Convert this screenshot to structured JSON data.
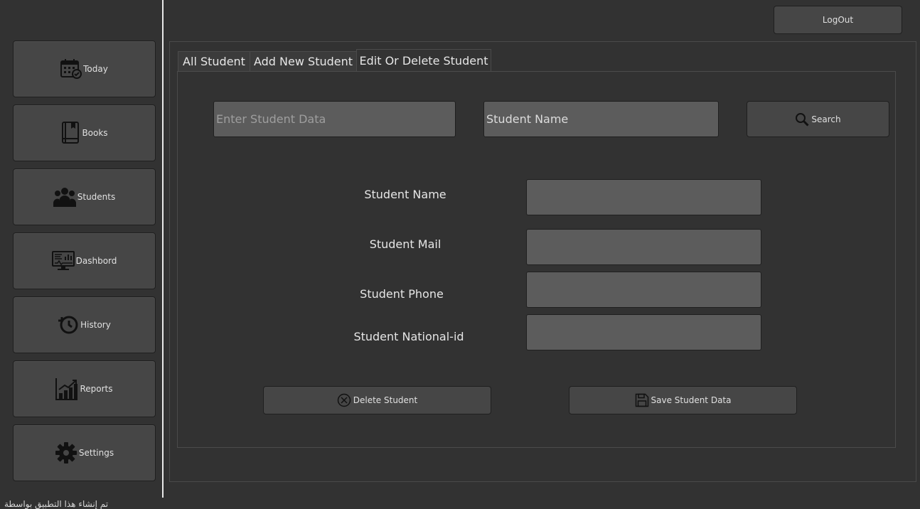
{
  "sidebar": {
    "items": [
      {
        "label": "Today",
        "icon": "calendar-icon"
      },
      {
        "label": "Books",
        "icon": "book-icon"
      },
      {
        "label": "Students",
        "icon": "users-icon"
      },
      {
        "label": "Dashbord",
        "icon": "monitor-chart-icon"
      },
      {
        "label": "History",
        "icon": "history-icon"
      },
      {
        "label": "Reports",
        "icon": "bar-chart-icon"
      },
      {
        "label": "Settings",
        "icon": "gear-icon"
      }
    ],
    "footer_text": "تم إنشاء هذا التطبيق بواسطة"
  },
  "header": {
    "logout_label": "LogOut"
  },
  "tabs": [
    {
      "label": "All Student",
      "active": false
    },
    {
      "label": "Add New Student",
      "active": false
    },
    {
      "label": "Edit Or Delete Student",
      "active": true
    }
  ],
  "search": {
    "data_placeholder": "Enter Student Data",
    "type_value": "Student Name",
    "button_label": "Search"
  },
  "form": {
    "name_label": "Student Name",
    "mail_label": "Student Mail",
    "phone_label": "Student Phone",
    "national_id_label": "Student National-id",
    "name_value": "",
    "mail_value": "",
    "phone_value": "",
    "national_id_value": ""
  },
  "actions": {
    "delete_label": "Delete Student",
    "save_label": "Save Student Data"
  },
  "colors": {
    "background": "#323232",
    "button": "#464646",
    "field": "#5c5c5c"
  }
}
